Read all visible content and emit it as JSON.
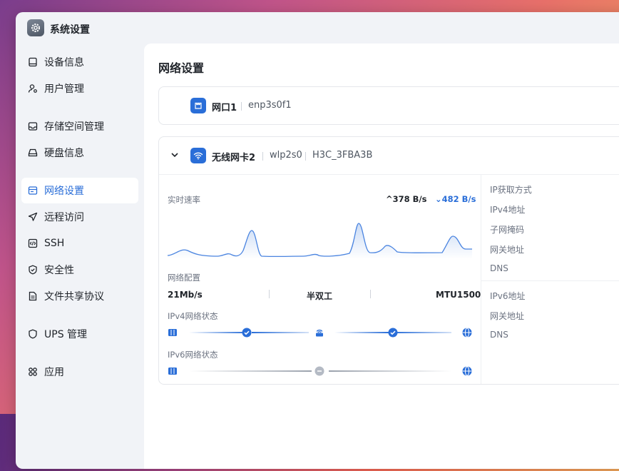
{
  "app": {
    "title": "系统设置",
    "icon": "gear-icon"
  },
  "sidebar": {
    "items": [
      {
        "label": "设备信息",
        "icon": "device-icon"
      },
      {
        "label": "用户管理",
        "icon": "user-gear-icon"
      },
      {
        "label": "存储空间管理",
        "icon": "storage-icon"
      },
      {
        "label": "硬盘信息",
        "icon": "disk-icon"
      },
      {
        "label": "网络设置",
        "icon": "network-icon",
        "active": true
      },
      {
        "label": "远程访问",
        "icon": "send-icon"
      },
      {
        "label": "SSH",
        "icon": "code-icon"
      },
      {
        "label": "安全性",
        "icon": "shield-check-icon"
      },
      {
        "label": "文件共享协议",
        "icon": "file-icon"
      },
      {
        "label": "UPS 管理",
        "icon": "shield-icon"
      },
      {
        "label": "应用",
        "icon": "apps-icon"
      }
    ]
  },
  "page": {
    "title": "网络设置"
  },
  "interfaces": [
    {
      "name": "网口1",
      "device": "enp3s0f1",
      "icon": "ethernet-port-icon"
    },
    {
      "name": "无线网卡2",
      "device": "wlp2s0",
      "ssid": "H3C_3FBA3B",
      "icon": "wifi-icon",
      "expanded": true
    }
  ],
  "realtime": {
    "label": "实时速率",
    "upload": "378 B/s",
    "download": "482 B/s"
  },
  "config": {
    "label": "网络配置",
    "speed": "21Mb/s",
    "duplex": "半双工",
    "mtu": "MTU1500"
  },
  "ipv4_status": {
    "label": "IPv4网络状态"
  },
  "ipv6_status": {
    "label": "IPv6网络状态"
  },
  "details": {
    "ipv4": [
      "IP获取方式",
      "IPv4地址",
      "子网掩码",
      "网关地址",
      "DNS"
    ],
    "ipv6": [
      "IPv6地址",
      "网关地址",
      "DNS"
    ]
  },
  "colors": {
    "accent": "#2a6ed8",
    "muted": "#9aa1ac"
  }
}
